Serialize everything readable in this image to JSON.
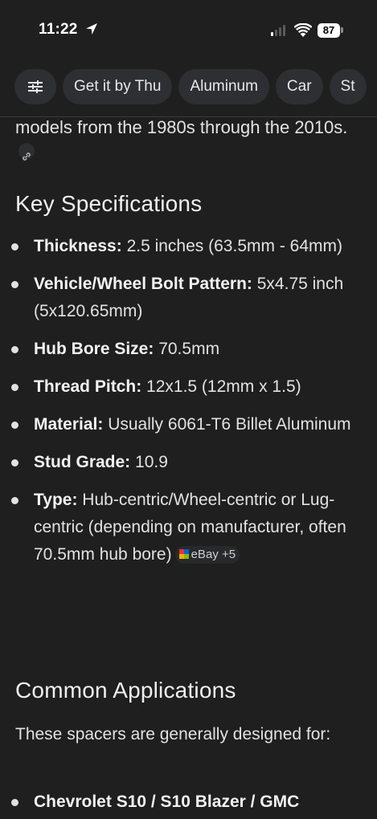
{
  "status_bar": {
    "time": "11:22",
    "battery": "87"
  },
  "chips": [
    {
      "label": "Get it by Thu"
    },
    {
      "label": "Aluminum"
    },
    {
      "label": "Car"
    },
    {
      "label": "St"
    }
  ],
  "content": {
    "intro": "models from the 1980s through the 2010s.",
    "specs_heading": "Key Specifications",
    "specs": [
      {
        "label": "Thickness:",
        "value": "2.5 inches (63.5mm - 64mm)"
      },
      {
        "label": "Vehicle/Wheel Bolt Pattern:",
        "value": "5x4.75 inch (5x120.65mm)"
      },
      {
        "label": "Hub Bore Size:",
        "value": "70.5mm"
      },
      {
        "label": "Thread Pitch:",
        "value": "12x1.5 (12mm x 1.5)"
      },
      {
        "label": "Material:",
        "value": "Usually 6061-T6 Billet Aluminum"
      },
      {
        "label": "Stud Grade:",
        "value": "10.9"
      },
      {
        "label": "Type:",
        "value": "Hub-centric/Wheel-centric or Lug-centric (depending on manufacturer, often 70.5mm hub bore)"
      }
    ],
    "source_chip": "eBay +5",
    "apps_heading": "Common Applications",
    "apps_intro": "These spacers are generally designed for:",
    "apps": [
      {
        "label": "Chevrolet S10 / S10 Blazer / GMC"
      }
    ]
  },
  "colors": {
    "background": "#1f1f1f",
    "chip_background": "#2e2f33",
    "text": "#e2e2e2"
  }
}
